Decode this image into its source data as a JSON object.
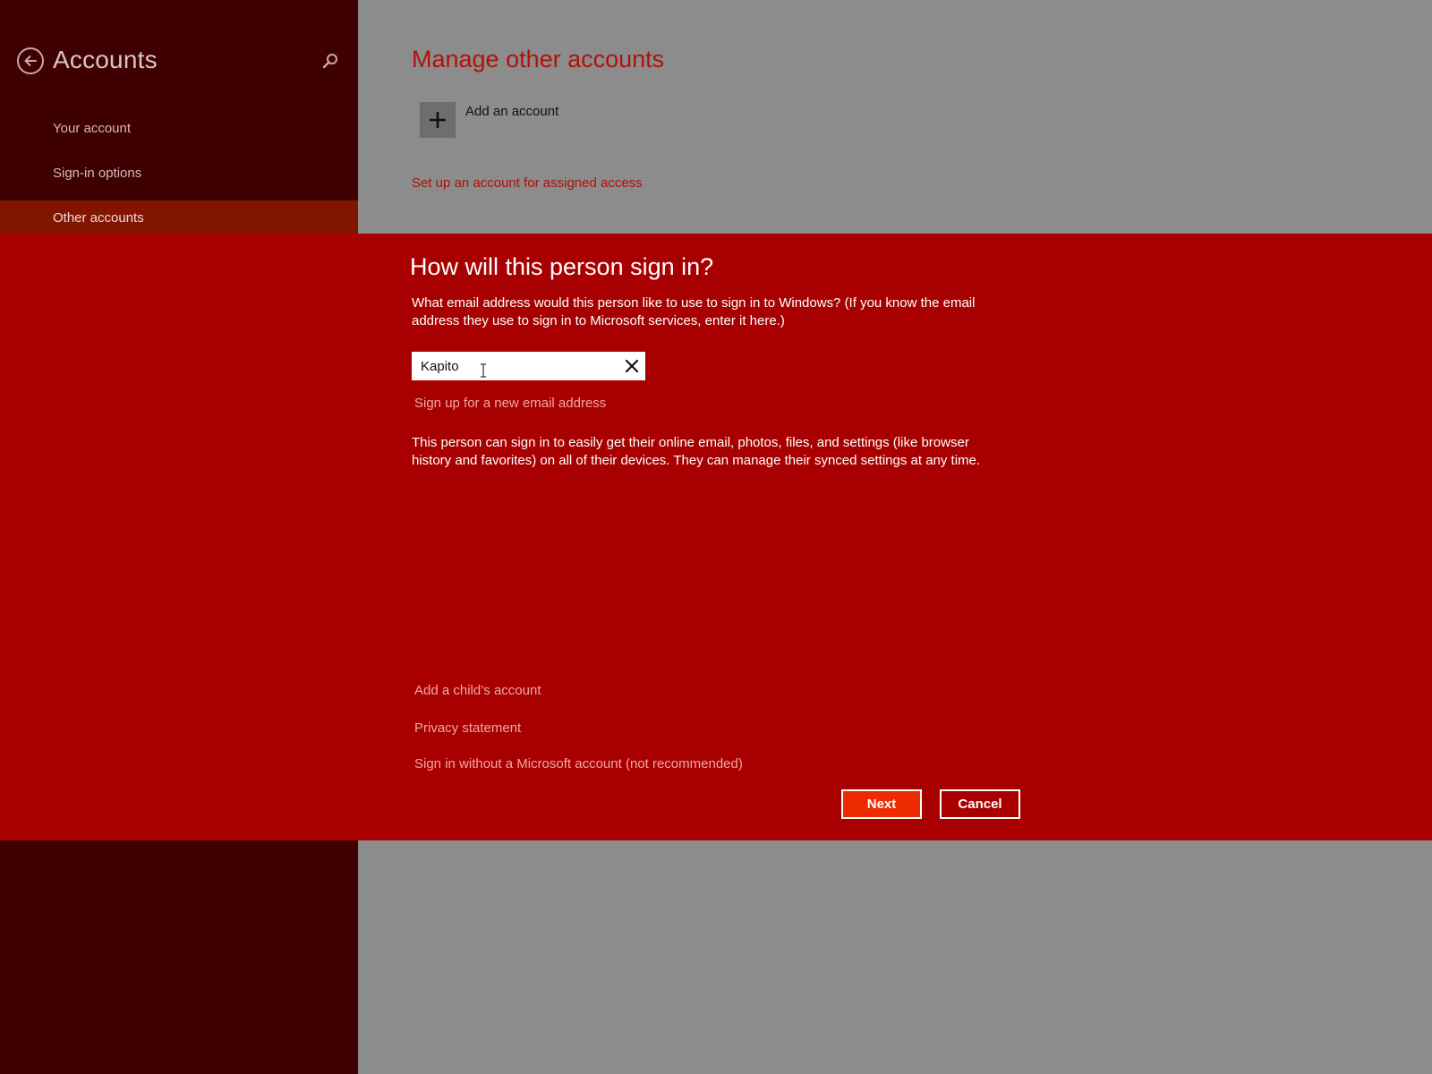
{
  "sidebar": {
    "title": "Accounts",
    "items": [
      {
        "label": "Your account"
      },
      {
        "label": "Sign-in options"
      },
      {
        "label": "Other accounts",
        "selected": true
      }
    ]
  },
  "main": {
    "heading": "Manage other accounts",
    "add_account_label": "Add an account",
    "assigned_access_link": "Set up an account for assigned access"
  },
  "dialog": {
    "title": "How will this person sign in?",
    "description": "What email address would this person like to use to sign in to Windows? (If you know the email address they use to sign in to Microsoft services, enter it here.)",
    "email_value": "Kapito",
    "signup_link": "Sign up for a new email address",
    "info": "This person can sign in to easily get their online email, photos, files, and settings (like browser history and favorites) on all of their devices. They can manage their synced settings at any time.",
    "links": {
      "child_account": "Add a child’s account",
      "privacy": "Privacy statement",
      "no_microsoft_account": "Sign in without a Microsoft account (not recommended)"
    },
    "buttons": {
      "next": "Next",
      "cancel": "Cancel"
    }
  },
  "colors": {
    "sidebar_bg": "#3e0000",
    "sidebar_selected": "#821500",
    "content_bg": "#8c8c8c",
    "modal_bg": "#a80000",
    "accent": "#ee2b00",
    "link_on_modal": "#f0a8a0"
  },
  "icons": {
    "back": "back-arrow-circle-icon",
    "search": "search-icon",
    "add": "plus-icon",
    "clear": "close-icon",
    "cursor": "text-cursor-icon"
  }
}
